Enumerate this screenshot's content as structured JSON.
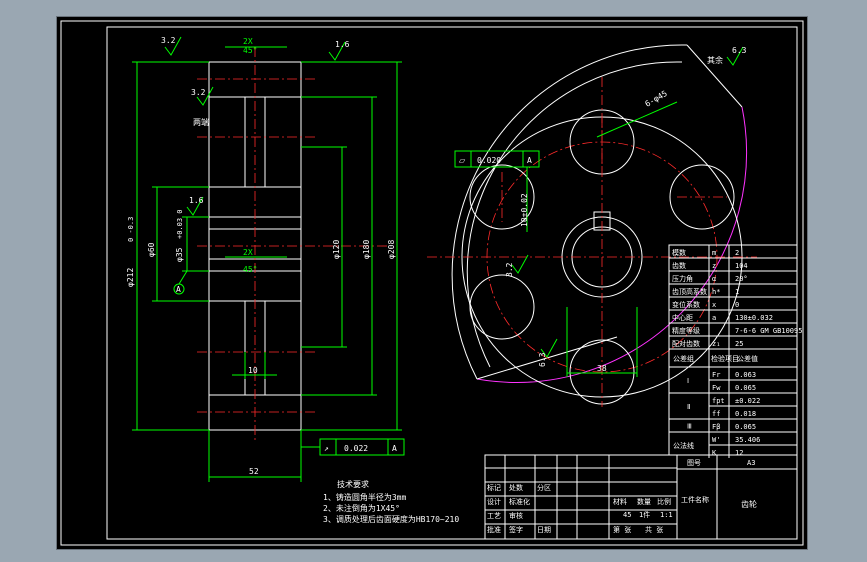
{
  "drawing": {
    "section": {
      "chamfer_top": "2X",
      "chamfer_top_angle": "45°",
      "chamfer_mid": "2X",
      "chamfer_mid_angle": "45°",
      "rough_top_left": "3.2",
      "rough_top_right": "1.6",
      "rough_side": "3.2",
      "side_note": "两端",
      "rough_bore": "1.6",
      "dia_tip": "φ212",
      "dia_tip_tol": "0 -0.3",
      "dia_hub": "φ60",
      "dia_bore": "φ35",
      "dia_bore_tol": "+0.03 0",
      "dia_120": "φ120",
      "dia_180": "φ180",
      "dia_208": "φ208",
      "web_thk": "10",
      "width": "52",
      "datum": "A",
      "runout_sym": "↗",
      "runout_val": "0.022",
      "runout_ref": "A"
    },
    "front": {
      "holes_label": "6-φ45",
      "flat_sym": "⏥",
      "flat_val": "0.020",
      "flat_ref": "A",
      "key_dim": "10±0.02",
      "rough_key": "3.2",
      "rough_bottom": "6.3",
      "bore_depth": "38",
      "rest_note": "其余",
      "rest_rough": "6.3"
    },
    "notes": {
      "title": "技术要求",
      "lines": [
        "1、铸造圆角半径为3mm",
        "2、未注倒角为1X45°",
        "3、调质处理后齿面硬度为HB170~210"
      ]
    },
    "params": {
      "rows": [
        [
          "模数",
          "m",
          "2"
        ],
        [
          "齿数",
          "z",
          "104"
        ],
        [
          "压力角",
          "α",
          "20°"
        ],
        [
          "齿顶高系数",
          "h*",
          "1"
        ],
        [
          "变位系数",
          "x",
          "0"
        ],
        [
          "中心距",
          "a",
          "130±0.032"
        ],
        [
          "精度等级",
          "",
          "7-6-6 GM GB10095"
        ],
        [
          "配对齿数",
          "z₁",
          "25"
        ]
      ],
      "group_header": [
        "公差组",
        "检验项目",
        "公差值"
      ],
      "groups": [
        {
          "name": "Ⅰ",
          "items": [
            [
              "Fr",
              "0.063"
            ],
            [
              "Fw",
              "0.065"
            ]
          ]
        },
        {
          "name": "Ⅱ",
          "items": [
            [
              "fpt",
              "±0.022"
            ],
            [
              "ff",
              "0.018"
            ]
          ]
        },
        {
          "name": "Ⅲ",
          "items": [
            [
              "Fβ",
              "0.065"
            ]
          ]
        }
      ],
      "span": [
        "公法线",
        "W'",
        "35.406",
        "K",
        "12"
      ]
    },
    "title_block": {
      "labels": [
        "标记",
        "处数",
        "分区",
        "更改文件号",
        "签名",
        "日期"
      ],
      "design": "设计",
      "std": "标准化",
      "review": "审核",
      "craft": "工艺",
      "approve": "批准",
      "material_label": "材料",
      "material": "45",
      "qty_label": "数量",
      "qty": "1件",
      "scale_label": "比例",
      "scale": "1:1",
      "sheet": "第 张",
      "total": "共 张",
      "drawing_no_label": "图号",
      "drawing_no": "A3",
      "part_label": "工件名称",
      "part_name": "齿轮",
      "sign_label": "签字",
      "date_label": "日期"
    }
  }
}
